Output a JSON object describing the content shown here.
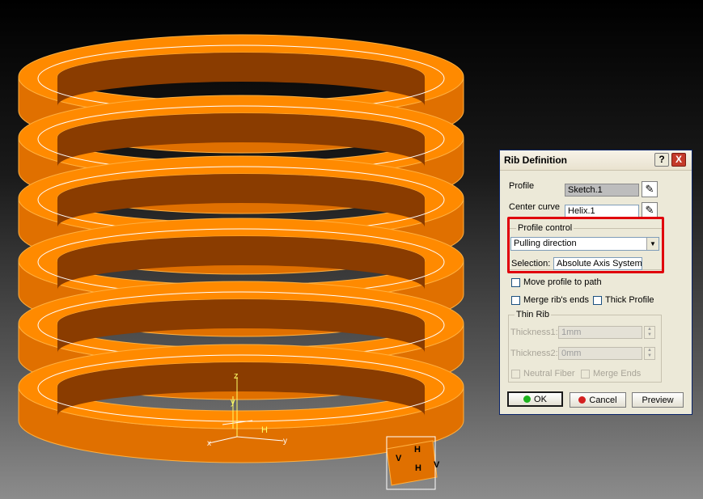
{
  "viewport": {
    "background": "#000000",
    "part_color": "#ff8a00",
    "axis_labels": {
      "z": "z",
      "y": "y",
      "x": "x",
      "h": "H",
      "v": "V"
    }
  },
  "dialog": {
    "title": "Rib Definition",
    "help_button": "?",
    "close_button": "X",
    "profile": {
      "label": "Profile",
      "value": "Sketch.1"
    },
    "center_curve": {
      "label": "Center curve",
      "value": "Helix.1"
    },
    "profile_control": {
      "legend": "Profile control",
      "selected_option": "Pulling direction",
      "selection_label": "Selection:",
      "selection_value": "Absolute Axis System\\"
    },
    "move_profile_to_path": "Move profile to path",
    "merge_ribs_ends": "Merge rib's ends",
    "thick_profile": "Thick Profile",
    "thin_rib": {
      "legend": "Thin Rib",
      "thickness1_label": "Thickness1:",
      "thickness1_value": "1mm",
      "thickness2_label": "Thickness2:",
      "thickness2_value": "0mm",
      "neutral_fiber": "Neutral Fiber",
      "merge_ends": "Merge Ends"
    },
    "buttons": {
      "ok": "OK",
      "cancel": "Cancel",
      "preview": "Preview"
    },
    "colors": {
      "highlight": "#e0000c",
      "ok_dot": "#1db31d",
      "cancel_dot": "#d42020"
    }
  }
}
